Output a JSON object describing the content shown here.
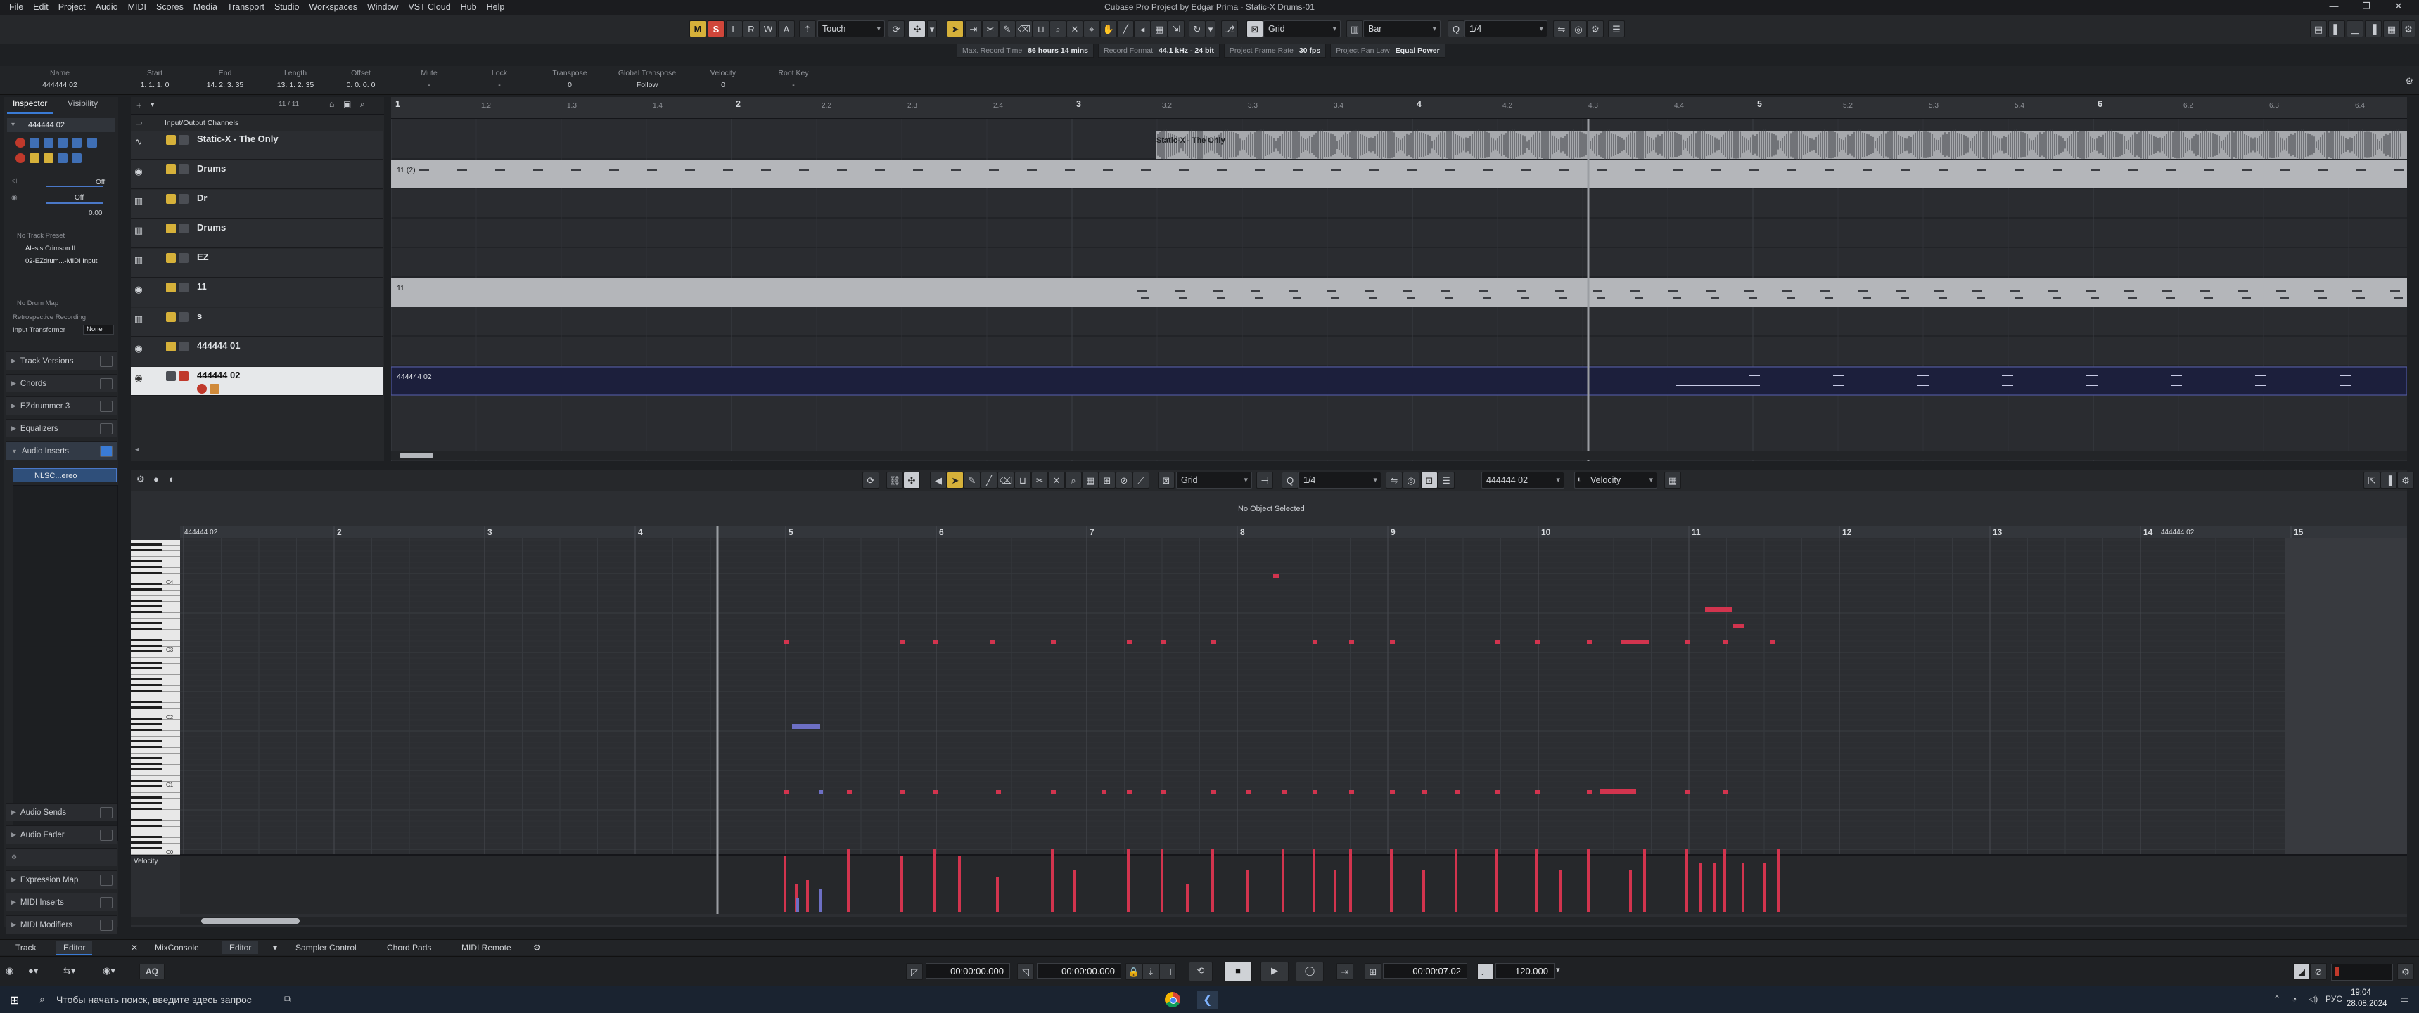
{
  "window": {
    "title": "Cubase Pro Project by Edgar Prima - Static-X Drums-01",
    "minimize": "—",
    "maximize": "❐",
    "close": "✕"
  },
  "menu": [
    "File",
    "Edit",
    "Project",
    "Audio",
    "MIDI",
    "Scores",
    "Media",
    "Transport",
    "Studio",
    "Workspaces",
    "Window",
    "VST Cloud",
    "Hub",
    "Help"
  ],
  "toolbar": {
    "m": "M",
    "s": "S",
    "l": "L",
    "r": "R",
    "w": "W",
    "a": "A",
    "automation_mode": "Touch",
    "snap_type": "Grid",
    "grid_type": "Bar",
    "quantize": "1/4"
  },
  "status": [
    {
      "label": "Max. Record Time",
      "value": "86 hours 14 mins"
    },
    {
      "label": "Record Format",
      "value": "44.1 kHz - 24 bit"
    },
    {
      "label": "Project Frame Rate",
      "value": "30 fps"
    },
    {
      "label": "Project Pan Law",
      "value": "Equal Power"
    }
  ],
  "infoline": [
    {
      "h": "Name",
      "v": "444444 02"
    },
    {
      "h": "Start",
      "v": "1. 1. 1.   0"
    },
    {
      "h": "End",
      "v": "14. 2. 3.  35"
    },
    {
      "h": "Length",
      "v": "13. 1. 2.  35"
    },
    {
      "h": "Offset",
      "v": "0. 0. 0.   0"
    },
    {
      "h": "Mute",
      "v": "-"
    },
    {
      "h": "Lock",
      "v": "-"
    },
    {
      "h": "Transpose",
      "v": "0"
    },
    {
      "h": "Global Transpose",
      "v": "Follow"
    },
    {
      "h": "Velocity",
      "v": "0"
    },
    {
      "h": "Root Key",
      "v": "-"
    }
  ],
  "inspector": {
    "tab_inspector": "Inspector",
    "tab_visibility": "Visibility",
    "track_name": "444444 02",
    "off1": "Off",
    "off2": "Off",
    "vol": "0.00",
    "no_track_preset": "No Track Preset",
    "instrument": "Alesis Crimson II",
    "routing": "02-EZdrum...-MIDI Input",
    "no_drum_map": "No Drum Map",
    "retro_rec": "Retrospective Recording",
    "input_transformer": "Input Transformer",
    "input_transformer_val": "None",
    "sections": [
      "Track Versions",
      "Chords",
      "EZdrummer 3",
      "Equalizers",
      "Audio Inserts"
    ],
    "insert_slot": "NLSC...ereo",
    "bottom_sections": [
      "Audio Sends",
      "Audio Fader",
      "",
      "Expression Map",
      "MIDI Inserts",
      "MIDI Modifiers"
    ]
  },
  "tracklist": {
    "counter": "11 / 11",
    "io_label": "Input/Output Channels",
    "tracks": [
      {
        "name": "Static-X - The Only",
        "type": "audio"
      },
      {
        "name": "Drums",
        "type": "midi"
      },
      {
        "name": "Dr",
        "type": "instrument"
      },
      {
        "name": "Drums",
        "type": "instrument"
      },
      {
        "name": "EZ",
        "type": "instrument"
      },
      {
        "name": "11",
        "type": "midi"
      },
      {
        "name": "s",
        "type": "instrument"
      },
      {
        "name": "444444 01",
        "type": "midi"
      },
      {
        "name": "444444 02",
        "type": "midi"
      }
    ]
  },
  "arrange": {
    "bars": [
      "1",
      "2",
      "3",
      "4",
      "5",
      "6"
    ],
    "subbeats": [
      "1.2",
      "1.3",
      "1.4",
      "2.2",
      "2.3",
      "2.4",
      "3.2",
      "3.3",
      "3.4",
      "4.2",
      "4.3",
      "4.4",
      "5.2",
      "5.3",
      "5.4",
      "6.2",
      "6.3",
      "6.4"
    ],
    "event_audio": "Static-X - The Only",
    "event_drums": "11 (2)",
    "event_11": "11",
    "event_444": "444444 02"
  },
  "editor": {
    "snap": "Grid",
    "quantize": "1/4",
    "part": "444444 02",
    "lane": "Velocity",
    "no_object": "No Object Selected",
    "part_label": "444444 02",
    "end_label": "444444 02",
    "bars": [
      "2",
      "3",
      "4",
      "5",
      "6",
      "7",
      "8",
      "9",
      "10",
      "11",
      "12",
      "13",
      "14",
      "15"
    ],
    "key_labels": [
      "C4",
      "C3",
      "C2",
      "C1",
      "C0"
    ],
    "velocity_label": "Velocity"
  },
  "bottomtabs": {
    "track": "Track",
    "editor": "Editor",
    "mixconsole": "MixConsole",
    "editor2": "Editor",
    "sampler": "Sampler Control",
    "chord": "Chord Pads",
    "midi_remote": "MIDI Remote"
  },
  "transport": {
    "left_locator": "00:00:00.000",
    "right_locator": "00:00:00.000",
    "position": "00:00:07.02",
    "tempo": "120.000",
    "aq": "AQ"
  },
  "taskbar": {
    "search_placeholder": "Чтобы начать поиск, введите здесь запрос",
    "lang": "РУС",
    "time": "19:04",
    "date": "28.08.2024"
  },
  "colors": {
    "midi_note": "#d2344e",
    "midi_note_blue": "#6d6fc4",
    "selected_part": "#1c1f3c",
    "accent_yellow": "#d6b13a"
  }
}
